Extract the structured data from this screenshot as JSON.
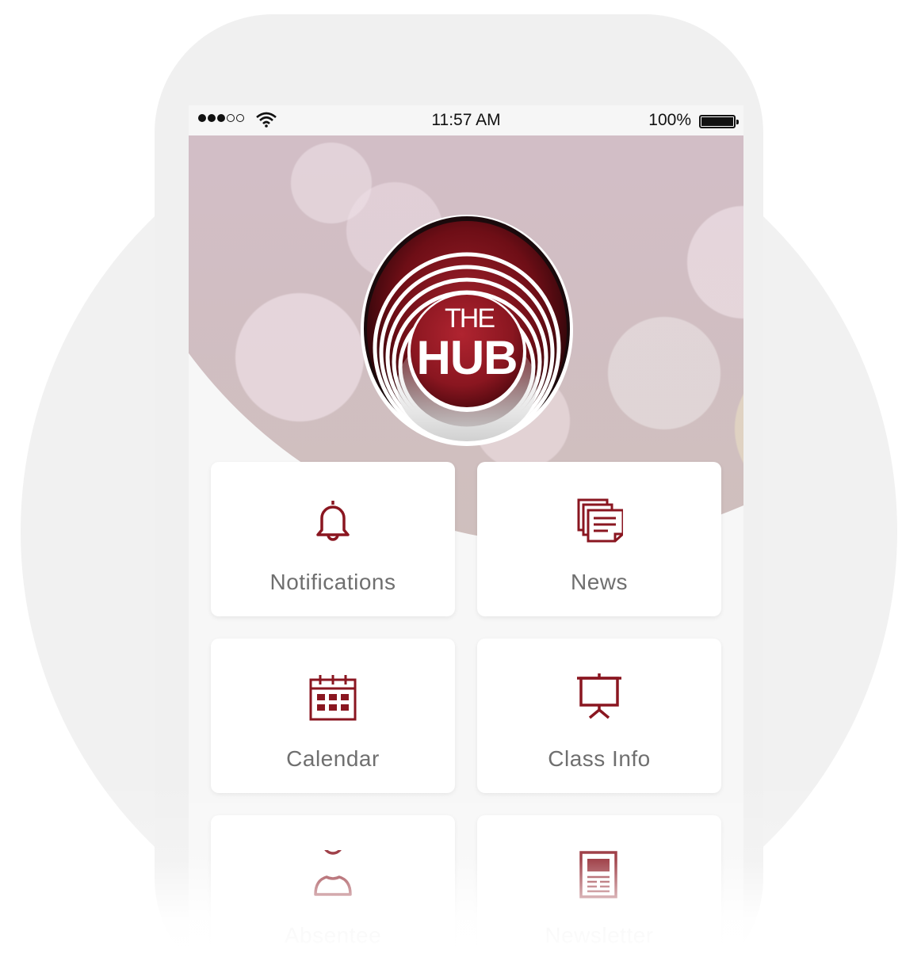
{
  "status_bar": {
    "time": "11:57 AM",
    "battery": "100%",
    "signal_icon": "signal-dots-icon",
    "wifi_icon": "wifi-icon",
    "battery_icon": "battery-icon"
  },
  "logo": {
    "line1": "THE",
    "line2": "HUB"
  },
  "colors": {
    "accent": "#8a1620",
    "tile_text": "#6f6f6f"
  },
  "tiles": [
    {
      "label": "Notifications",
      "icon": "bell-icon"
    },
    {
      "label": "News",
      "icon": "newspaper-stack-icon"
    },
    {
      "label": "Calendar",
      "icon": "calendar-icon"
    },
    {
      "label": "Class Info",
      "icon": "presentation-board-icon"
    },
    {
      "label": "Absentee",
      "icon": "person-icon"
    },
    {
      "label": "Newsletter",
      "icon": "newsletter-icon"
    }
  ]
}
